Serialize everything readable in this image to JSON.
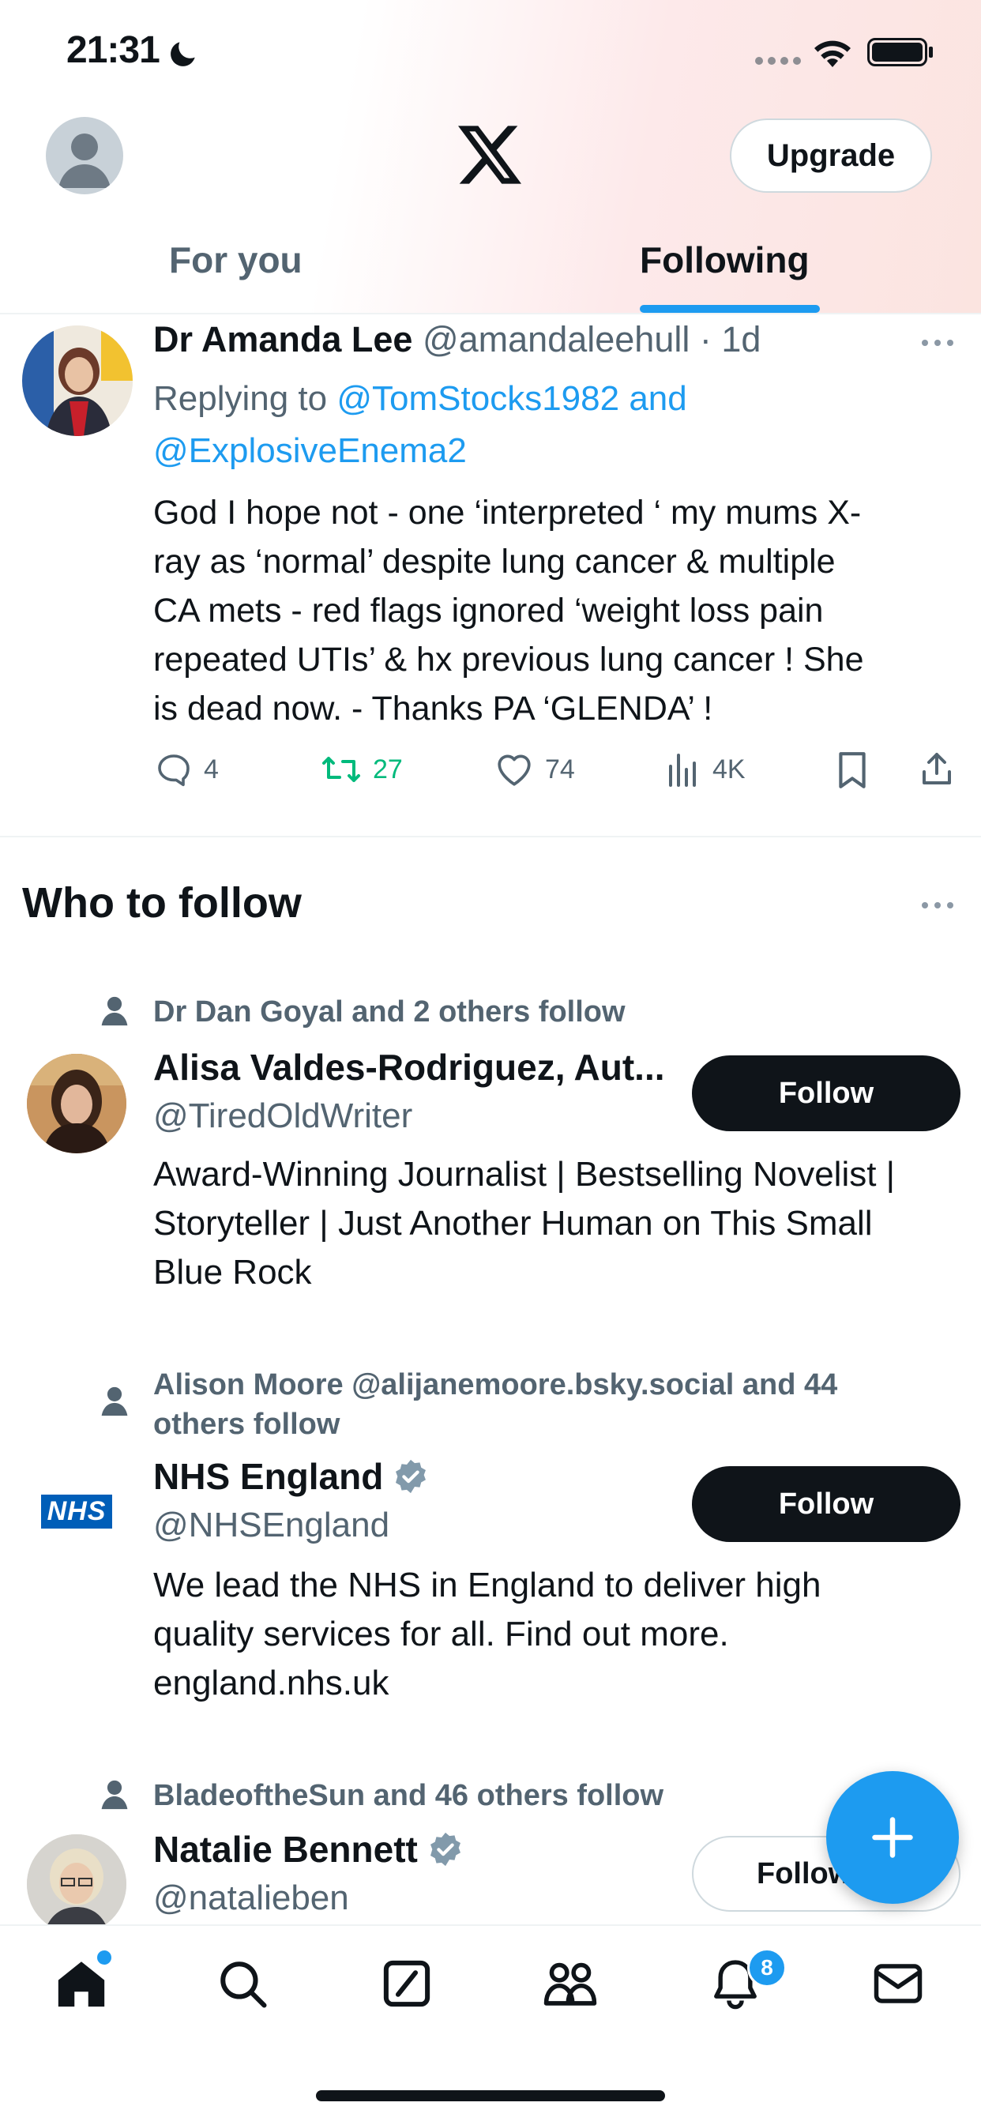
{
  "status_bar": {
    "time": "21:31"
  },
  "header": {
    "upgrade_label": "Upgrade"
  },
  "tabs": {
    "for_you": "For you",
    "following": "Following"
  },
  "tweet": {
    "author_name": "Dr Amanda Lee",
    "author_handle": "@amandaleehull",
    "time_sep": "·",
    "time": "1d",
    "replying_prefix": "Replying to",
    "replying_to_1": "@TomStocks1982",
    "replying_and": "and",
    "replying_to_2": "@ExplosiveEnema2",
    "text_lines": [
      "God I hope not - one ‘interpreted ‘ my mums X-",
      "ray as ‘normal’ despite lung cancer &  multiple",
      "CA mets - red flags ignored ‘weight loss pain",
      "repeated UTIs’ & hx previous lung cancer ! She",
      "is dead now. - Thanks PA  ‘GLENDA’ !"
    ],
    "replies": "4",
    "retweets": "27",
    "likes": "74",
    "views": "4K",
    "retweet_color": "#00ba7c"
  },
  "who_to_follow": {
    "title": "Who to follow",
    "items": [
      {
        "social": "Dr Dan Goyal and 2 others follow",
        "name": "Alisa Valdes-Rodriguez, Aut...",
        "handle": "@TiredOldWriter",
        "bio_lines": [
          "Award-Winning Journalist | Bestselling Novelist |",
          "Storyteller | Just Another Human on This Small",
          "Blue Rock"
        ],
        "follow_label": "Follow"
      },
      {
        "social_lines": [
          "Alison Moore @alijanemoore.bsky.social and 44",
          "others follow"
        ],
        "name": "NHS England",
        "handle": "@NHSEngland",
        "logo_text": "NHS",
        "bio_lines": [
          "We lead the NHS in England to deliver high",
          "quality services for all. Find out more.",
          "england.nhs.uk"
        ],
        "follow_label": "Follow"
      },
      {
        "social": "BladeoftheSun and 46 others follow",
        "name": "Natalie Bennett",
        "handle": "@natalieben",
        "follow_label": "Follow"
      }
    ]
  },
  "tabbar": {
    "notifications_badge": "8"
  },
  "colors": {
    "accent": "#1d9bf0",
    "text": "#0f1419",
    "muted": "#536471",
    "verified": "#829aab"
  }
}
